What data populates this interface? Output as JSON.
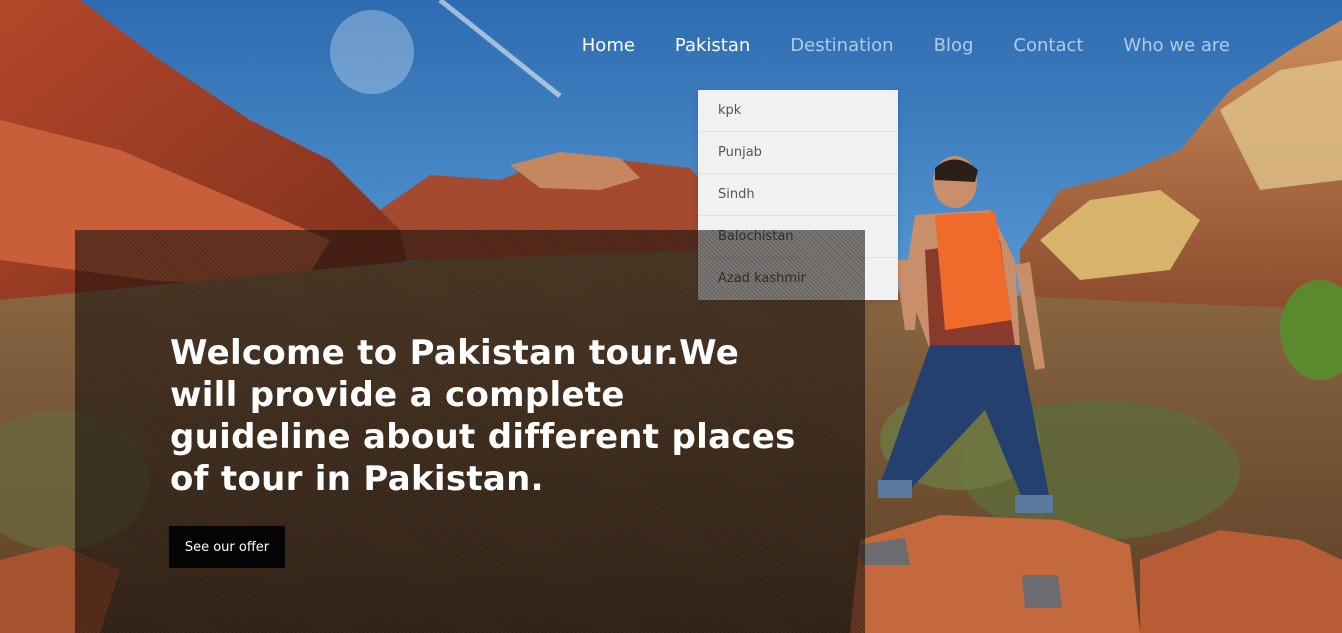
{
  "nav": {
    "items": [
      {
        "label": "Home",
        "state": "active"
      },
      {
        "label": "Pakistan",
        "state": "open"
      },
      {
        "label": "Destination",
        "state": "normal"
      },
      {
        "label": "Blog",
        "state": "normal"
      },
      {
        "label": "Contact",
        "state": "normal"
      },
      {
        "label": "Who we are",
        "state": "normal"
      }
    ]
  },
  "dropdown": {
    "parent": "Pakistan",
    "items": [
      "kpk",
      "Punjab",
      "Sindh",
      "Balochistan",
      "Azad kashmir"
    ]
  },
  "hero": {
    "title": "Welcome to Pakistan tour.We will provide a complete guideline about different places of tour in Pakistan.",
    "button_label": "See our offer"
  },
  "colors": {
    "nav_active": "#ffffff",
    "nav_inactive": "#c9d6e3",
    "dropdown_bg": "#f1f1f1",
    "dropdown_text": "#555555",
    "button_bg": "#050505",
    "hero_text": "#ffffff"
  }
}
